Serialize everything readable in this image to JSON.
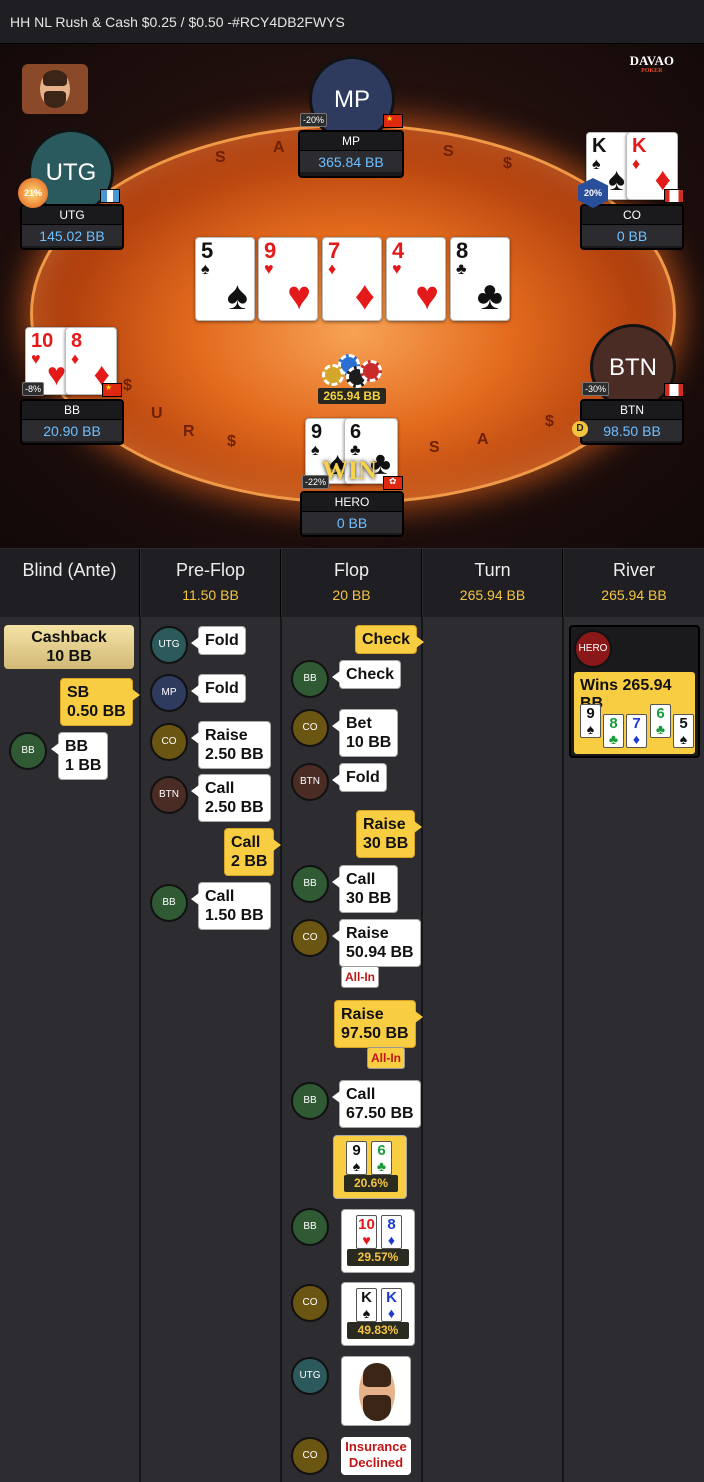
{
  "title": "HH NL Rush & Cash $0.25 / $0.50 -#RCY4DB2FWYS",
  "logo": {
    "main": "DAVAO",
    "sub": "POKER"
  },
  "table": {
    "seats": {
      "mp": {
        "avatar": "MP",
        "name": "MP",
        "stack": "365.84 BB",
        "pct": "-20%",
        "flag": "China"
      },
      "utg": {
        "avatar": "UTG",
        "name": "UTG",
        "stack": "145.02 BB",
        "pct": "21%",
        "flag": "Guatemala"
      },
      "co": {
        "name": "CO",
        "stack": "0 BB",
        "pct": "20%",
        "flag": "Canada",
        "cards": [
          {
            "rank": "K",
            "suit": "♠"
          },
          {
            "rank": "K",
            "suit": "♦"
          }
        ]
      },
      "bb": {
        "name": "BB",
        "stack": "20.90 BB",
        "pct": "-8%",
        "flag": "China",
        "cards": [
          {
            "rank": "10",
            "suit": "♥"
          },
          {
            "rank": "8",
            "suit": "♦"
          }
        ]
      },
      "btn": {
        "avatar": "BTN",
        "name": "BTN",
        "stack": "98.50 BB",
        "pct": "-30%",
        "flag": "Canada"
      },
      "hero": {
        "name": "HERO",
        "stack": "0 BB",
        "pct": "-22%",
        "flag": "Hong Kong",
        "cards": [
          {
            "rank": "9",
            "suit": "♠"
          },
          {
            "rank": "6",
            "suit": "♣"
          }
        ]
      }
    },
    "board": [
      {
        "rank": "5",
        "suit": "♠"
      },
      {
        "rank": "9",
        "suit": "♥"
      },
      {
        "rank": "7",
        "suit": "♦"
      },
      {
        "rank": "4",
        "suit": "♥"
      },
      {
        "rank": "8",
        "suit": "♣"
      }
    ],
    "pot": "265.94 BB",
    "win_text": "WIN",
    "dealer_button": "D",
    "felt_glyphs": [
      "$",
      "A",
      "S",
      "$",
      "A",
      "S",
      "U",
      "R",
      "$",
      "$",
      "A",
      "S",
      "$"
    ]
  },
  "columns": [
    {
      "title": "Blind (Ante)",
      "pot": ""
    },
    {
      "title": "Pre-Flop",
      "pot": "11.50 BB"
    },
    {
      "title": "Flop",
      "pot": "20 BB"
    },
    {
      "title": "Turn",
      "pot": "265.94 BB"
    },
    {
      "title": "River",
      "pot": "265.94 BB"
    }
  ],
  "blind": {
    "cashback": {
      "line1": "Cashback",
      "line2": "10 BB"
    },
    "sb": {
      "line1": "SB",
      "line2": "0.50 BB"
    },
    "bb": {
      "pos": "BB",
      "line1": "BB",
      "line2": "1 BB"
    }
  },
  "preflop": [
    {
      "pos": "UTG",
      "line1": "Fold",
      "line2": ""
    },
    {
      "pos": "MP",
      "line1": "Fold",
      "line2": ""
    },
    {
      "pos": "CO",
      "line1": "Raise",
      "line2": "2.50 BB"
    },
    {
      "pos": "BTN",
      "line1": "Call",
      "line2": "2.50 BB"
    },
    {
      "pos": "HERO",
      "line1": "Call",
      "line2": "2 BB"
    },
    {
      "pos": "BB",
      "line1": "Call",
      "line2": "1.50 BB"
    }
  ],
  "flop": {
    "actions": [
      {
        "pos": "HERO",
        "line1": "Check",
        "line2": ""
      },
      {
        "pos": "BB",
        "line1": "Check",
        "line2": ""
      },
      {
        "pos": "CO",
        "line1": "Bet",
        "line2": "10 BB"
      },
      {
        "pos": "BTN",
        "line1": "Fold",
        "line2": ""
      },
      {
        "pos": "HERO",
        "line1": "Raise",
        "line2": "30 BB"
      },
      {
        "pos": "BB",
        "line1": "Call",
        "line2": "30 BB"
      },
      {
        "pos": "CO",
        "line1": "Raise",
        "line2": "50.94 BB",
        "allin": "All-In"
      },
      {
        "pos": "HERO",
        "line1": "Raise",
        "line2": "97.50 BB",
        "allin": "All-In"
      },
      {
        "pos": "BB",
        "line1": "Call",
        "line2": "67.50 BB"
      }
    ],
    "equities": [
      {
        "pos": "HERO",
        "cards": [
          {
            "rank": "9",
            "suit": "♠"
          },
          {
            "rank": "6",
            "suit": "♣"
          }
        ],
        "pct": "20.6%"
      },
      {
        "pos": "BB",
        "cards": [
          {
            "rank": "10",
            "suit": "♥"
          },
          {
            "rank": "8",
            "suit": "♦"
          }
        ],
        "pct": "29.57%"
      },
      {
        "pos": "CO",
        "cards": [
          {
            "rank": "K",
            "suit": "♠"
          },
          {
            "rank": "K",
            "suit": "♦"
          }
        ],
        "pct": "49.83%"
      }
    ],
    "emote_pos": "UTG",
    "insurance": {
      "pos": "CO",
      "line1": "Insurance",
      "line2": "Declined"
    }
  },
  "river": {
    "winner": "HERO",
    "text": "Wins 265.94 BB",
    "cards": [
      {
        "rank": "9",
        "suit": "♠"
      },
      {
        "rank": "8",
        "suit": "♣"
      },
      {
        "rank": "7",
        "suit": "♦"
      },
      {
        "rank": "6",
        "suit": "♣"
      },
      {
        "rank": "5",
        "suit": "♠"
      }
    ]
  }
}
